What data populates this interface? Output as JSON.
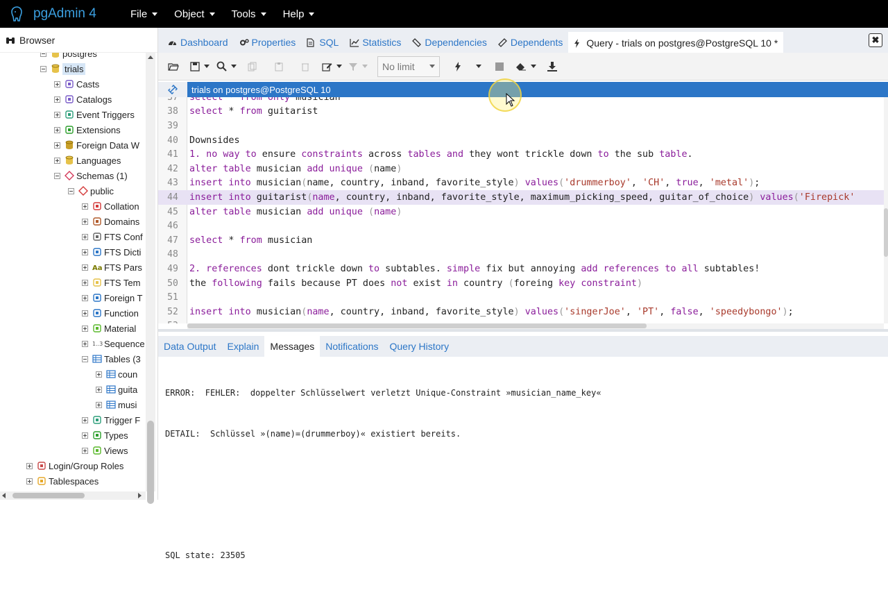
{
  "app": {
    "name": "pgAdmin 4",
    "menu": [
      {
        "label": "File"
      },
      {
        "label": "Object"
      },
      {
        "label": "Tools"
      },
      {
        "label": "Help"
      }
    ]
  },
  "browser": {
    "title": "Browser",
    "tree": [
      {
        "label": "postgres",
        "icon": "database-icon",
        "depth": 3,
        "toggle": "minus"
      },
      {
        "label": "trials",
        "icon": "database-icon",
        "depth": 3,
        "toggle": "minus",
        "selected": true
      },
      {
        "label": "Casts",
        "icon": "casts-icon",
        "depth": 4,
        "toggle": "plus"
      },
      {
        "label": "Catalogs",
        "icon": "catalogs-icon",
        "depth": 4,
        "toggle": "plus"
      },
      {
        "label": "Event Triggers",
        "icon": "event-trigger-icon",
        "depth": 4,
        "toggle": "plus"
      },
      {
        "label": "Extensions",
        "icon": "extensions-icon",
        "depth": 4,
        "toggle": "plus"
      },
      {
        "label": "Foreign Data W",
        "icon": "foreign-data-icon",
        "depth": 4,
        "toggle": "plus"
      },
      {
        "label": "Languages",
        "icon": "languages-icon",
        "depth": 4,
        "toggle": "plus"
      },
      {
        "label": "Schemas (1)",
        "icon": "schemas-icon",
        "depth": 4,
        "toggle": "minus"
      },
      {
        "label": "public",
        "icon": "schema-icon",
        "depth": 5,
        "toggle": "minus"
      },
      {
        "label": "Collation",
        "icon": "collation-icon",
        "depth": 6,
        "toggle": "plus"
      },
      {
        "label": "Domains",
        "icon": "domains-icon",
        "depth": 6,
        "toggle": "plus"
      },
      {
        "label": "FTS Conf",
        "icon": "fts-config-icon",
        "depth": 6,
        "toggle": "plus"
      },
      {
        "label": "FTS Dicti",
        "icon": "fts-dictionary-icon",
        "depth": 6,
        "toggle": "plus"
      },
      {
        "label": "FTS Pars",
        "icon": "fts-parser-icon",
        "depth": 6,
        "toggle": "plus"
      },
      {
        "label": "FTS Tem",
        "icon": "fts-template-icon",
        "depth": 6,
        "toggle": "plus"
      },
      {
        "label": "Foreign T",
        "icon": "foreign-table-icon",
        "depth": 6,
        "toggle": "plus"
      },
      {
        "label": "Function",
        "icon": "function-icon",
        "depth": 6,
        "toggle": "plus"
      },
      {
        "label": "Material",
        "icon": "materialized-view-icon",
        "depth": 6,
        "toggle": "plus"
      },
      {
        "label": "Sequence",
        "icon": "sequence-icon",
        "depth": 6,
        "toggle": "plus"
      },
      {
        "label": "Tables (3",
        "icon": "tables-icon",
        "depth": 6,
        "toggle": "minus"
      },
      {
        "label": "coun",
        "icon": "table-icon",
        "depth": 7,
        "toggle": "plus"
      },
      {
        "label": "guita",
        "icon": "table-icon",
        "depth": 7,
        "toggle": "plus"
      },
      {
        "label": "musi",
        "icon": "table-icon",
        "depth": 7,
        "toggle": "plus"
      },
      {
        "label": "Trigger F",
        "icon": "trigger-function-icon",
        "depth": 6,
        "toggle": "plus"
      },
      {
        "label": "Types",
        "icon": "types-icon",
        "depth": 6,
        "toggle": "plus"
      },
      {
        "label": "Views",
        "icon": "views-icon",
        "depth": 6,
        "toggle": "plus"
      },
      {
        "label": "Login/Group Roles",
        "icon": "roles-icon",
        "depth": 2,
        "toggle": "plus"
      },
      {
        "label": "Tablespaces",
        "icon": "tablespaces-icon",
        "depth": 2,
        "toggle": "plus"
      }
    ]
  },
  "tabs": [
    {
      "label": "Dashboard",
      "icon": "dashboard-icon"
    },
    {
      "label": "Properties",
      "icon": "properties-icon"
    },
    {
      "label": "SQL",
      "icon": "sql-icon"
    },
    {
      "label": "Statistics",
      "icon": "statistics-icon"
    },
    {
      "label": "Dependencies",
      "icon": "dependencies-icon"
    },
    {
      "label": "Dependents",
      "icon": "dependents-icon"
    },
    {
      "label": "Query - trials on postgres@PostgreSQL 10 *",
      "icon": "query-icon",
      "active": true
    }
  ],
  "close_label": "✖",
  "toolbar": {
    "limit_value": "No limit"
  },
  "connection": {
    "label": "trials on postgres@PostgreSQL 10"
  },
  "editor": {
    "lines": [
      {
        "n": "37",
        "tokens": [
          [
            "kw",
            "select"
          ],
          [
            "",
            " * "
          ],
          [
            "kw",
            "from"
          ],
          [
            "",
            " "
          ],
          [
            "kw",
            "only"
          ],
          [
            "",
            " musician"
          ]
        ]
      },
      {
        "n": "38",
        "tokens": [
          [
            "kw",
            "select"
          ],
          [
            "",
            " * "
          ],
          [
            "kw",
            "from"
          ],
          [
            "",
            " guitarist"
          ]
        ]
      },
      {
        "n": "39",
        "tokens": []
      },
      {
        "n": "40",
        "tokens": [
          [
            "",
            "Downsides"
          ]
        ]
      },
      {
        "n": "41",
        "tokens": [
          [
            "kw",
            "1. no"
          ],
          [
            "",
            " "
          ],
          [
            "kw",
            "way"
          ],
          [
            "",
            " "
          ],
          [
            "kw",
            "to"
          ],
          [
            "",
            " ensure "
          ],
          [
            "kw",
            "constraints"
          ],
          [
            "",
            " across "
          ],
          [
            "kw",
            "tables"
          ],
          [
            "",
            " "
          ],
          [
            "kw",
            "and"
          ],
          [
            "",
            " they wont trickle down "
          ],
          [
            "kw",
            "to"
          ],
          [
            "",
            " the sub "
          ],
          [
            "kw",
            "table"
          ],
          [
            "",
            "."
          ]
        ]
      },
      {
        "n": "42",
        "tokens": [
          [
            "kw",
            "alter table"
          ],
          [
            "",
            " musician "
          ],
          [
            "kw",
            "add unique"
          ],
          [
            "",
            " "
          ],
          [
            "punc",
            "("
          ],
          [
            "",
            "name"
          ],
          [
            "punc",
            ")"
          ]
        ]
      },
      {
        "n": "43",
        "tokens": [
          [
            "kw",
            "insert into"
          ],
          [
            "",
            " musician"
          ],
          [
            "punc",
            "("
          ],
          [
            "",
            "name, country, inband, favorite_style"
          ],
          [
            "punc",
            ")"
          ],
          [
            "",
            " "
          ],
          [
            "kw",
            "values"
          ],
          [
            "punc",
            "("
          ],
          [
            "str",
            "'drummerboy'"
          ],
          [
            "",
            ", "
          ],
          [
            "str",
            "'CH'"
          ],
          [
            "",
            ", "
          ],
          [
            "kw",
            "true"
          ],
          [
            "",
            ", "
          ],
          [
            "str",
            "'metal'"
          ],
          [
            "punc",
            ")"
          ],
          [
            "",
            ";"
          ]
        ]
      },
      {
        "n": "44",
        "hl": true,
        "tokens": [
          [
            "kw",
            "insert into"
          ],
          [
            "",
            " guitarist"
          ],
          [
            "punc",
            "("
          ],
          [
            "kw",
            "name"
          ],
          [
            "",
            ", country, inband, favorite_style, maximum_picking_speed, guitar_of_choice"
          ],
          [
            "punc",
            ")"
          ],
          [
            "",
            " "
          ],
          [
            "kw",
            "values"
          ],
          [
            "punc",
            "("
          ],
          [
            "str",
            "'Firepick'"
          ]
        ]
      },
      {
        "n": "45",
        "tokens": [
          [
            "kw",
            "alter table"
          ],
          [
            "",
            " musician "
          ],
          [
            "kw",
            "add unique"
          ],
          [
            "",
            " "
          ],
          [
            "punc",
            "("
          ],
          [
            "kw",
            "name"
          ],
          [
            "punc",
            ")"
          ]
        ]
      },
      {
        "n": "46",
        "tokens": []
      },
      {
        "n": "47",
        "tokens": [
          [
            "kw",
            "select"
          ],
          [
            "",
            " * "
          ],
          [
            "kw",
            "from"
          ],
          [
            "",
            " musician"
          ]
        ]
      },
      {
        "n": "48",
        "tokens": []
      },
      {
        "n": "49",
        "tokens": [
          [
            "kw",
            "2. references"
          ],
          [
            "",
            " dont trickle down "
          ],
          [
            "kw",
            "to"
          ],
          [
            "",
            " subtables. "
          ],
          [
            "kw",
            "simple"
          ],
          [
            "",
            " fix but annoying "
          ],
          [
            "kw",
            "add references"
          ],
          [
            "",
            " "
          ],
          [
            "kw",
            "to"
          ],
          [
            "",
            " "
          ],
          [
            "kw",
            "all"
          ],
          [
            "",
            " subtables!"
          ]
        ]
      },
      {
        "n": "50",
        "tokens": [
          [
            "",
            "the "
          ],
          [
            "kw",
            "following"
          ],
          [
            "",
            " fails because PT does "
          ],
          [
            "kw",
            "not"
          ],
          [
            "",
            " exist "
          ],
          [
            "kw",
            "in"
          ],
          [
            "",
            " country "
          ],
          [
            "punc",
            "("
          ],
          [
            "",
            "foreing "
          ],
          [
            "kw",
            "key constraint"
          ],
          [
            "punc",
            ")"
          ]
        ]
      },
      {
        "n": "51",
        "tokens": []
      },
      {
        "n": "52",
        "tokens": [
          [
            "kw",
            "insert into"
          ],
          [
            "",
            " musician"
          ],
          [
            "punc",
            "("
          ],
          [
            "kw",
            "name"
          ],
          [
            "",
            ", country, inband, favorite_style"
          ],
          [
            "punc",
            ")"
          ],
          [
            "",
            " "
          ],
          [
            "kw",
            "values"
          ],
          [
            "punc",
            "("
          ],
          [
            "str",
            "'singerJoe'"
          ],
          [
            "",
            ", "
          ],
          [
            "str",
            "'PT'"
          ],
          [
            "",
            ", "
          ],
          [
            "kw",
            "false"
          ],
          [
            "",
            ", "
          ],
          [
            "str",
            "'speedybongo'"
          ],
          [
            "punc",
            ")"
          ],
          [
            "",
            ";"
          ]
        ]
      },
      {
        "n": "53",
        "tokens": []
      }
    ]
  },
  "result_tabs": [
    {
      "label": "Data Output"
    },
    {
      "label": "Explain"
    },
    {
      "label": "Messages",
      "active": true
    },
    {
      "label": "Notifications"
    },
    {
      "label": "Query History"
    }
  ],
  "messages": {
    "line1": "ERROR:  FEHLER:  doppelter Schlüsselwert verletzt Unique-Constraint »musician_name_key«",
    "line2": "DETAIL:  Schlüssel »(name)=(drummerboy)« existiert bereits.",
    "line3": "",
    "line4": "",
    "line5": "SQL state: 23505"
  },
  "colors": {
    "accent": "#2c76c7",
    "topbar": "#000000",
    "keyword": "#8a1c9a",
    "string": "#a8392b"
  }
}
